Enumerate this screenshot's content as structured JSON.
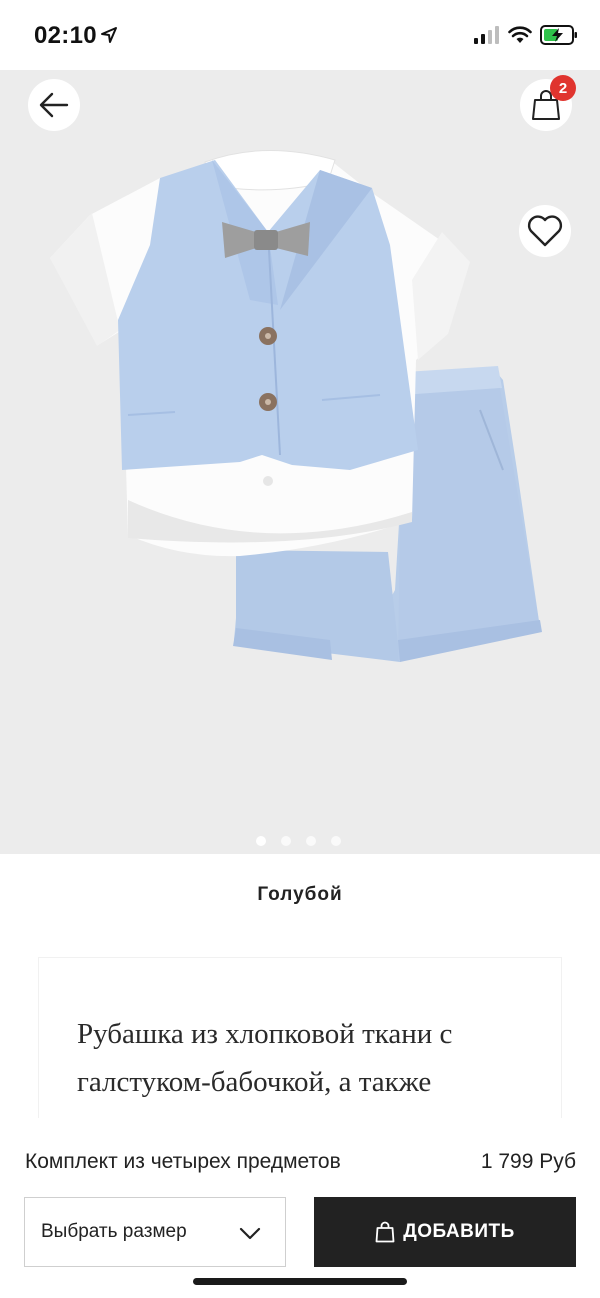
{
  "status_bar": {
    "time": "02:10",
    "location_icon": "location-arrow-icon",
    "signal_icon": "cellular-signal-icon",
    "wifi_icon": "wifi-icon",
    "battery_icon": "battery-charging-icon"
  },
  "header": {
    "back_icon": "arrow-left-icon",
    "cart_icon": "shopping-bag-icon",
    "cart_count": "2",
    "favorite_icon": "heart-icon"
  },
  "gallery": {
    "image_subject": "product-photo-outfit",
    "dot_count": 4,
    "active_index": 0
  },
  "product": {
    "color_name": "Голубой",
    "description": "Рубашка из хлопковой ткани с галстуком-бабочкой, а также льняной",
    "title": "Комплект из четырех предметов",
    "price": "1 799 Руб"
  },
  "actions": {
    "size_select_label": "Выбрать размер",
    "size_chevron_icon": "chevron-down-icon",
    "add_icon": "shopping-bag-icon",
    "add_label": "ДОБАВИТЬ"
  },
  "colors": {
    "accent_badge": "#e0342e",
    "button_dark": "#222222",
    "image_bg": "#ececec",
    "vest_blue": "#b9cfec"
  }
}
